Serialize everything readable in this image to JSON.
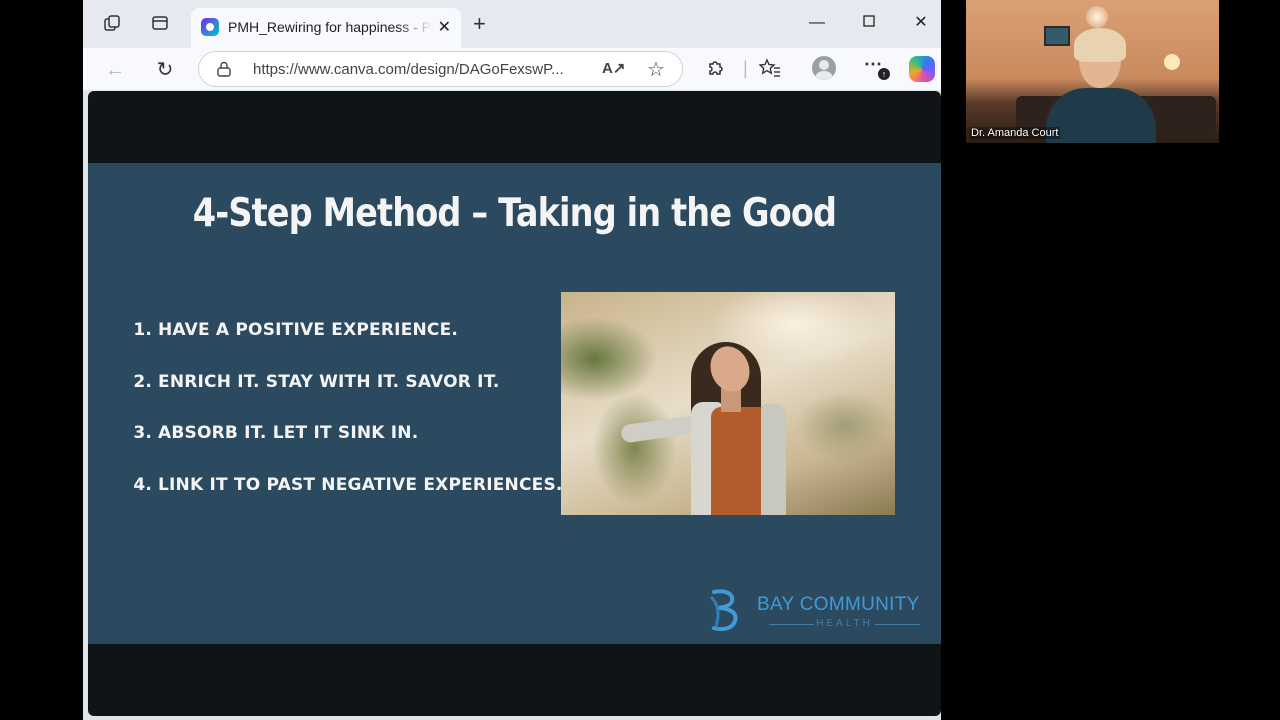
{
  "browser": {
    "tab_title": "PMH_Rewiring for happiness - Presentation",
    "url": "https://www.canva.com/design/DAGoFexswP...",
    "read_aloud": "A͉"
  },
  "slide": {
    "title": "4-Step Method – Taking in the Good",
    "steps": [
      {
        "num": "1.",
        "text": "HAVE A POSITIVE EXPERIENCE."
      },
      {
        "num": "2.",
        "text": "ENRICH IT. STAY WITH IT. SAVOR IT."
      },
      {
        "num": "3.",
        "text": "ABSORB IT. LET IT SINK IN."
      },
      {
        "num": "4.",
        "text": "LINK IT TO PAST NEGATIVE EXPERIENCES."
      }
    ],
    "logo_name": "BAY COMMUNITY",
    "logo_sub": "HEALTH"
  },
  "webcam": {
    "participant_name": "Dr. Amanda Court"
  },
  "colors": {
    "slide_bg": "#2b4a5f",
    "logo_blue": "#3f9ad6"
  }
}
